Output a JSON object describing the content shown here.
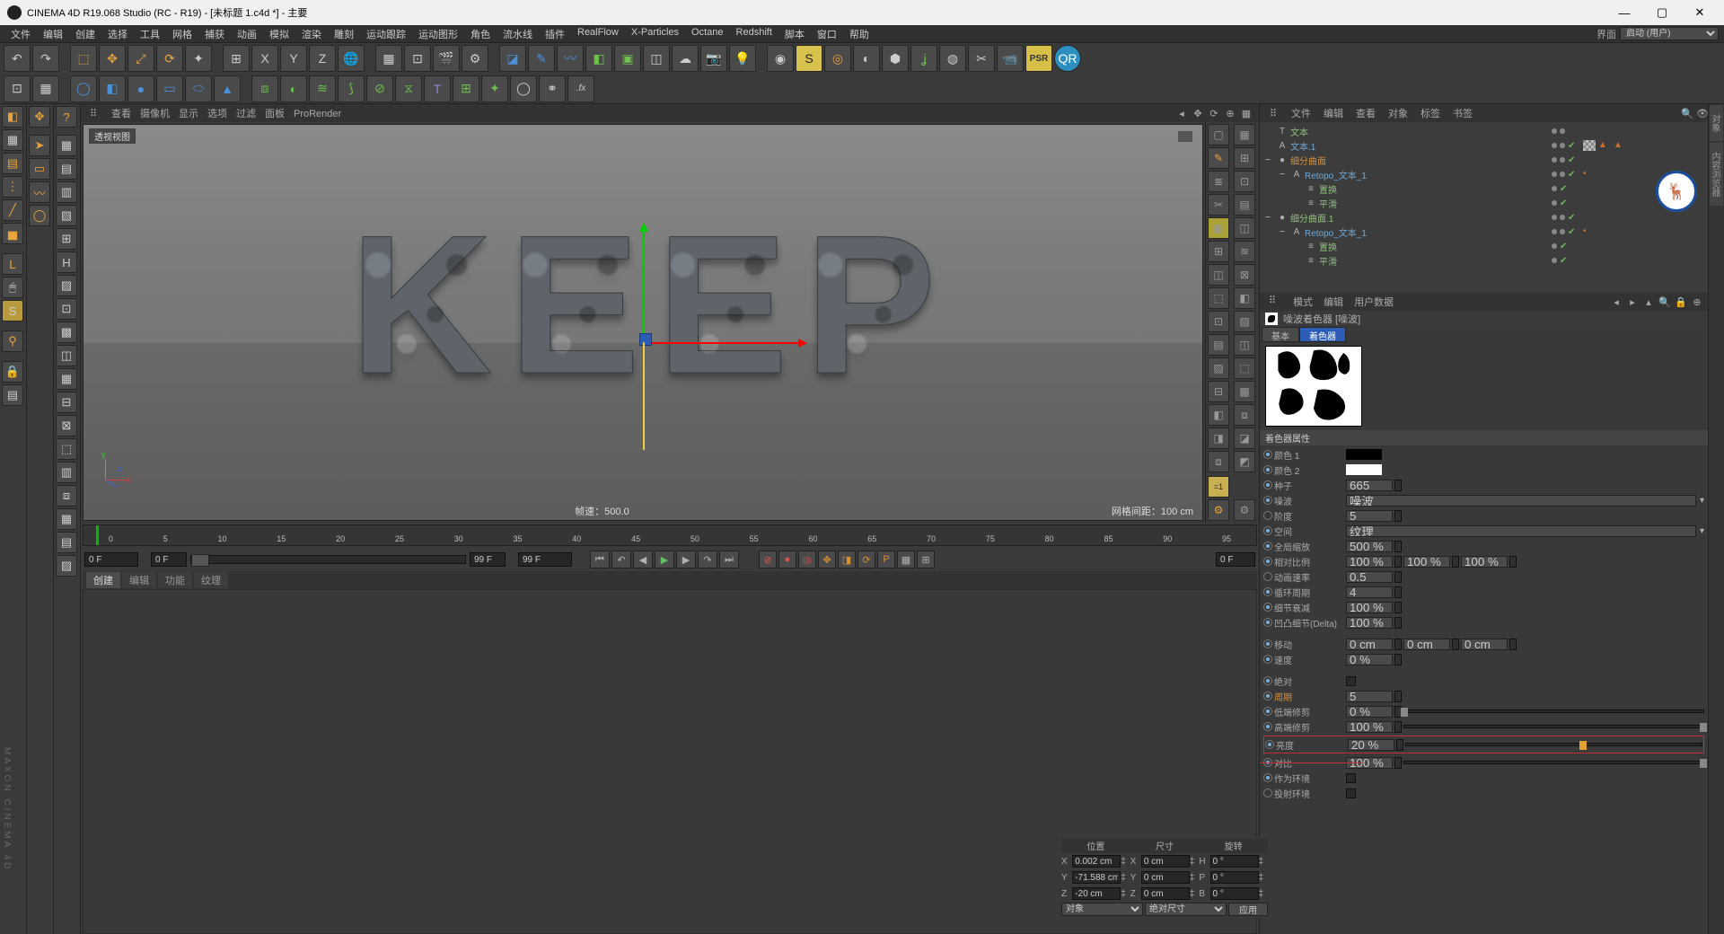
{
  "title": "CINEMA 4D R19.068 Studio (RC - R19) - [未标题 1.c4d *] - 主要",
  "menubar": {
    "items": [
      "文件",
      "编辑",
      "创建",
      "选择",
      "工具",
      "网格",
      "捕获",
      "动画",
      "模拟",
      "渲染",
      "雕刻",
      "运动跟踪",
      "运动图形",
      "角色",
      "流水线",
      "插件",
      "RealFlow",
      "X-Particles",
      "Octane",
      "Redshift",
      "脚本",
      "窗口",
      "帮助"
    ],
    "layout_label": "界面",
    "layout_value": "启动 (用户)"
  },
  "viewport": {
    "tabs": [
      "查看",
      "摄像机",
      "显示",
      "选项",
      "过滤",
      "面板",
      "ProRender"
    ],
    "label": "透视视图",
    "fps_label": "帧速：500.0",
    "grid_label": "网格间距：100 cm",
    "keep_text": [
      "K",
      "E",
      "E",
      "P"
    ]
  },
  "timeline": {
    "ticks": [
      "0",
      "5",
      "10",
      "15",
      "20",
      "25",
      "30",
      "35",
      "40",
      "45",
      "50",
      "55",
      "60",
      "65",
      "70",
      "75",
      "80",
      "85",
      "90",
      "95"
    ],
    "cur_left": "0 F",
    "range_left": "0 F",
    "range_right": "99 F",
    "cur_right": "99 F",
    "right_val": "0 F"
  },
  "bottom_tabs": [
    "创建",
    "编辑",
    "功能",
    "纹理"
  ],
  "coords": {
    "hdrs": [
      "位置",
      "尺寸",
      "旋转"
    ],
    "rows": [
      {
        "axis": "X",
        "pos": "0.002 cm",
        "size": "0 cm",
        "rot": "0 °",
        "rl": "H",
        "sl": "X"
      },
      {
        "axis": "Y",
        "pos": "-71.588 cm",
        "size": "0 cm",
        "rot": "0 °",
        "rl": "P",
        "sl": "Y"
      },
      {
        "axis": "Z",
        "pos": "-20 cm",
        "size": "0 cm",
        "rot": "0 °",
        "rl": "B",
        "sl": "Z"
      }
    ],
    "sel1": "对象",
    "sel2": "绝对尺寸",
    "btn": "应用"
  },
  "objmgr": {
    "tabs": [
      "文件",
      "编辑",
      "查看",
      "对象",
      "标签",
      "书签"
    ],
    "items": [
      {
        "d": 0,
        "exp": "",
        "icon": "T",
        "name": "文本",
        "cls": "",
        "dots": [
          "gr",
          "gr"
        ],
        "tags": []
      },
      {
        "d": 0,
        "exp": "",
        "icon": "A",
        "name": "文本.1",
        "cls": "blue",
        "dots": [
          "gr",
          "gr"
        ],
        "tags": [
          "chk",
          "tex",
          "tri",
          "tri"
        ]
      },
      {
        "d": 0,
        "exp": "−",
        "icon": "●",
        "name": "细分曲面",
        "cls": "orange",
        "dots": [
          "gr",
          "gr"
        ],
        "tags": [
          "chk"
        ]
      },
      {
        "d": 1,
        "exp": "−",
        "icon": "A",
        "name": "Retopo_文本_1",
        "cls": "blue",
        "dots": [
          "gr",
          "gr"
        ],
        "tags": [
          "chk",
          "dot"
        ]
      },
      {
        "d": 2,
        "exp": "",
        "icon": "≡",
        "name": "置换",
        "cls": "",
        "dots": [
          "gr"
        ],
        "tags": [
          "chk"
        ]
      },
      {
        "d": 2,
        "exp": "",
        "icon": "≡",
        "name": "平滑",
        "cls": "",
        "dots": [
          "gr"
        ],
        "tags": [
          "chk"
        ]
      },
      {
        "d": 0,
        "exp": "−",
        "icon": "●",
        "name": "细分曲面.1",
        "cls": "",
        "dots": [
          "gr",
          "gr"
        ],
        "tags": [
          "chk"
        ]
      },
      {
        "d": 1,
        "exp": "−",
        "icon": "A",
        "name": "Retopo_文本_1",
        "cls": "blue",
        "dots": [
          "gr",
          "gr"
        ],
        "tags": [
          "chk",
          "dot"
        ]
      },
      {
        "d": 2,
        "exp": "",
        "icon": "≡",
        "name": "置换",
        "cls": "",
        "dots": [
          "gr"
        ],
        "tags": [
          "chk"
        ]
      },
      {
        "d": 2,
        "exp": "",
        "icon": "≡",
        "name": "平滑",
        "cls": "",
        "dots": [
          "gr"
        ],
        "tags": [
          "chk"
        ]
      }
    ]
  },
  "attr": {
    "hdr_tabs": [
      "模式",
      "编辑",
      "用户数据"
    ],
    "title": "噪波着色器 [噪波]",
    "tabs": [
      "基本",
      "着色器"
    ],
    "section": "着色器属性",
    "props": [
      {
        "t": "color",
        "label": "颜色 1",
        "c1": "#000",
        "c2": "#000"
      },
      {
        "t": "color",
        "label": "颜色 2",
        "c1": "#fff",
        "c2": "#fff"
      },
      {
        "t": "num",
        "label": "种子",
        "val": "665"
      },
      {
        "t": "sel",
        "label": "噪波",
        "val": "噪波"
      },
      {
        "t": "num",
        "label": "阶度",
        "val": "5",
        "dis": true
      },
      {
        "t": "sel",
        "label": "空间",
        "val": "纹理"
      },
      {
        "t": "num",
        "label": "全局缩放",
        "val": "500 %"
      },
      {
        "t": "multi",
        "label": "相对比例",
        "vals": [
          "100 %",
          "100 %",
          "100 %"
        ]
      },
      {
        "t": "num",
        "label": "动画速率",
        "val": "0.5",
        "dis": true
      },
      {
        "t": "num",
        "label": "循环周期",
        "val": "4"
      },
      {
        "t": "num",
        "label": "细节衰减",
        "val": "100 %"
      },
      {
        "t": "num",
        "label": "凹凸细节(Delta)",
        "val": "100 %"
      },
      {
        "t": "gap"
      },
      {
        "t": "multi",
        "label": "移动",
        "vals": [
          "0 cm",
          "0 cm",
          "0 cm"
        ]
      },
      {
        "t": "num",
        "label": "速度",
        "val": "0 %"
      },
      {
        "t": "gap"
      },
      {
        "t": "chk",
        "label": "绝对"
      },
      {
        "t": "num",
        "label": "周期",
        "val": "5",
        "cls": "orange"
      },
      {
        "t": "slider",
        "label": "低端修剪",
        "val": "0 %",
        "pos": 0
      },
      {
        "t": "slider",
        "label": "高端修剪",
        "val": "100 %",
        "pos": 100
      },
      {
        "t": "slider",
        "label": "亮度",
        "val": "20 %",
        "pos": 60,
        "hl": true,
        "hlcolor": "#e0a030"
      },
      {
        "t": "slider",
        "label": "对比",
        "val": "100 %",
        "pos": 100,
        "strike": true
      },
      {
        "t": "chk",
        "label": "作为环境"
      },
      {
        "t": "chk",
        "label": "投射环境",
        "dis": true
      }
    ]
  },
  "watermark": "MAXON CINEMA 4D"
}
